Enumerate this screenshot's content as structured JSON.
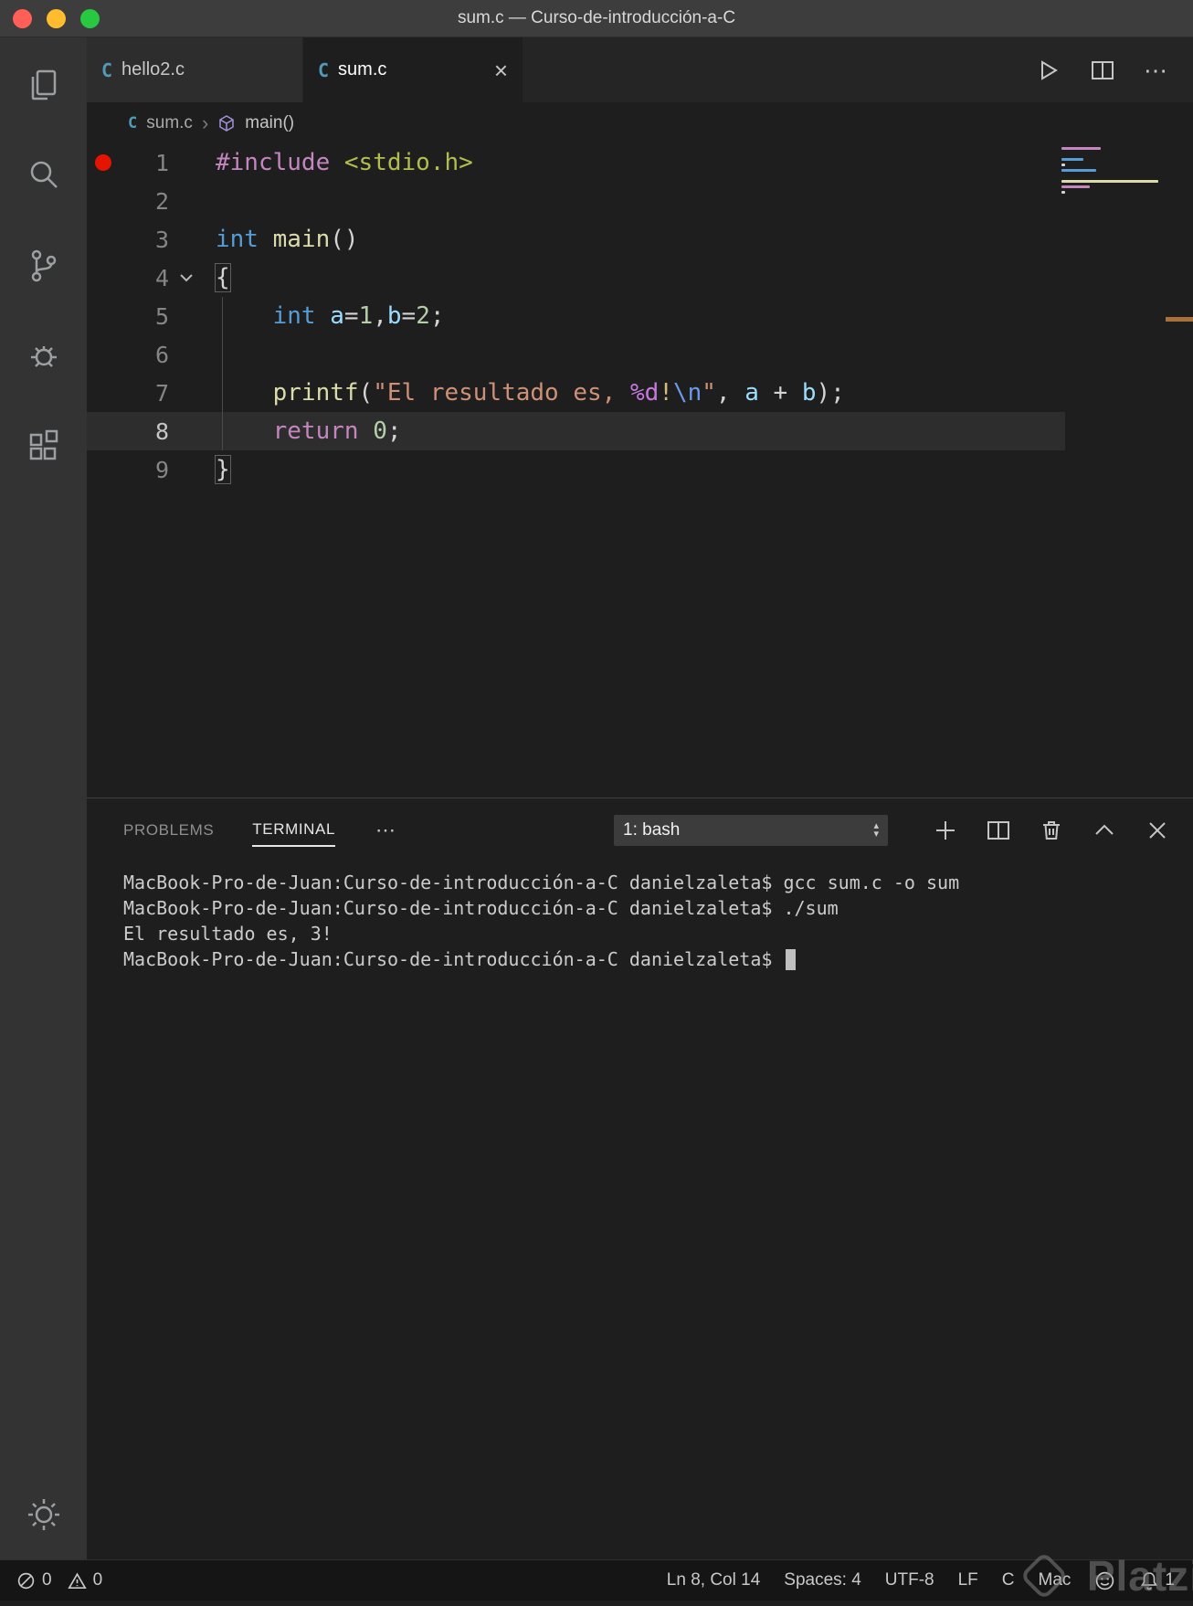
{
  "window": {
    "title": "sum.c — Curso-de-introducción-a-C"
  },
  "activity_bar": {
    "items": [
      "explorer",
      "search",
      "source-control",
      "debug",
      "extensions"
    ],
    "bottom": "settings"
  },
  "tabs": [
    {
      "icon": "C",
      "label": "hello2.c"
    },
    {
      "icon": "C",
      "label": "sum.c",
      "close": "×"
    }
  ],
  "editor_actions": {
    "more": "⋯"
  },
  "breadcrumb": {
    "file_icon": "C",
    "file": "sum.c",
    "separator": "›",
    "symbol": "main()"
  },
  "editor": {
    "lines": [
      {
        "num": "1",
        "breakpoint": true,
        "segments": [
          [
            "pp",
            "#include"
          ],
          [
            "pl",
            " "
          ],
          [
            "hdr",
            "<stdio.h>"
          ]
        ]
      },
      {
        "num": "2",
        "segments": []
      },
      {
        "num": "3",
        "segments": [
          [
            "kw",
            "int"
          ],
          [
            "pl",
            " "
          ],
          [
            "fn",
            "main"
          ],
          [
            "pl",
            "()"
          ]
        ]
      },
      {
        "num": "4",
        "fold": true,
        "segments": [
          [
            "brk",
            "{"
          ]
        ]
      },
      {
        "num": "5",
        "segments": [
          [
            "pl",
            "    "
          ],
          [
            "kw",
            "int"
          ],
          [
            "pl",
            " "
          ],
          [
            "v",
            "a"
          ],
          [
            "op",
            "="
          ],
          [
            "n",
            "1"
          ],
          [
            "pl",
            ","
          ],
          [
            "v",
            "b"
          ],
          [
            "op",
            "="
          ],
          [
            "n",
            "2"
          ],
          [
            "pl",
            ";"
          ]
        ]
      },
      {
        "num": "6",
        "segments": []
      },
      {
        "num": "7",
        "segments": [
          [
            "pl",
            "    "
          ],
          [
            "fn",
            "printf"
          ],
          [
            "pl",
            "("
          ],
          [
            "s",
            "\"El resultado es, "
          ],
          [
            "f",
            "%d"
          ],
          [
            "sy",
            "!"
          ],
          [
            "esc",
            "\\n"
          ],
          [
            "s",
            "\""
          ],
          [
            "pl",
            ", "
          ],
          [
            "v",
            "a"
          ],
          [
            "pl",
            " "
          ],
          [
            "op",
            "+"
          ],
          [
            "pl",
            " "
          ],
          [
            "v",
            "b"
          ],
          [
            "pl",
            ");"
          ]
        ]
      },
      {
        "num": "8",
        "highlight": true,
        "segments": [
          [
            "pl",
            "    "
          ],
          [
            "kw2",
            "return"
          ],
          [
            "pl",
            " "
          ],
          [
            "n",
            "0"
          ],
          [
            "pl",
            ";"
          ]
        ]
      },
      {
        "num": "9",
        "segments": [
          [
            "brk",
            "}"
          ]
        ]
      }
    ]
  },
  "panel": {
    "tabs": [
      {
        "label": "PROBLEMS",
        "active": false
      },
      {
        "label": "TERMINAL",
        "active": true
      }
    ],
    "more": "⋯",
    "shell_select": "1: bash",
    "actions": [
      "new-terminal",
      "split-terminal",
      "kill-terminal",
      "maximize-panel",
      "close-panel"
    ],
    "terminal_lines": [
      "MacBook-Pro-de-Juan:Curso-de-introducción-a-C danielzaleta$ gcc sum.c -o sum",
      "MacBook-Pro-de-Juan:Curso-de-introducción-a-C danielzaleta$ ./sum",
      "El resultado es, 3!",
      "MacBook-Pro-de-Juan:Curso-de-introducción-a-C danielzaleta$ "
    ],
    "cursor": true
  },
  "status_bar": {
    "errors": "0",
    "warnings": "0",
    "items_right": [
      "Ln 8, Col 14",
      "Spaces: 4",
      "UTF-8",
      "LF",
      "C",
      "Mac"
    ],
    "notifications": "1"
  },
  "watermark": {
    "text": "Platzi"
  },
  "colors": {
    "file_icon": "#519aba",
    "breakpoint": "#e51400",
    "statusbar_bg": "#151515",
    "activitybar_bg": "#333333",
    "editor_bg": "#1e1e1e"
  }
}
